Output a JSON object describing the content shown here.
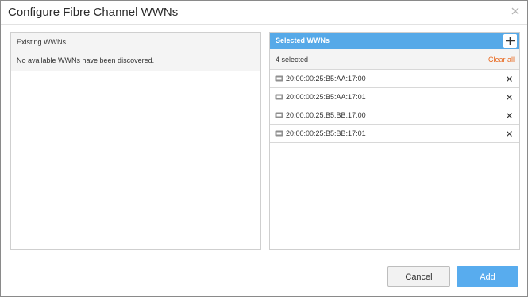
{
  "dialog": {
    "title": "Configure Fibre Channel WWNs"
  },
  "existing": {
    "header": "Existing WWNs",
    "empty_message": "No available WWNs have been discovered."
  },
  "selected": {
    "header": "Selected WWNs",
    "count_label": "4 selected",
    "clear_all_label": "Clear all",
    "items": [
      {
        "wwn": "20:00:00:25:B5:AA:17:00",
        "icon": "port-icon"
      },
      {
        "wwn": "20:00:00:25:B5:AA:17:01",
        "icon": "port-icon"
      },
      {
        "wwn": "20:00:00:25:B5:BB:17:00",
        "icon": "port-icon"
      },
      {
        "wwn": "20:00:00:25:B5:BB:17:01",
        "icon": "port-icon"
      }
    ]
  },
  "buttons": {
    "cancel_label": "Cancel",
    "add_label": "Add"
  },
  "colors": {
    "accent": "#56a9e8",
    "clear_link": "#e8661c",
    "add_button": "#58acee"
  }
}
